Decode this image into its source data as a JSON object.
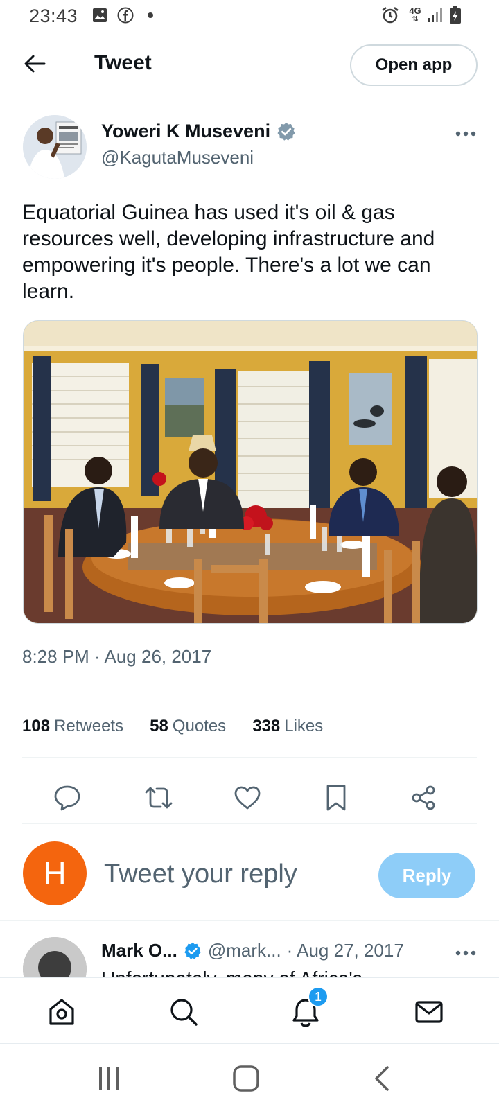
{
  "status_bar": {
    "time": "23:43",
    "icons": [
      "image-icon",
      "facebook-icon",
      "dot-icon",
      "alarm-icon",
      "4g-icon",
      "signal-icon",
      "battery-icon"
    ],
    "network": "4G"
  },
  "header": {
    "title": "Tweet",
    "open_app_label": "Open app"
  },
  "tweet": {
    "author_name": "Yoweri K Museveni",
    "author_handle": "@KagutaMuseveni",
    "text": "Equatorial Guinea has used it's oil & gas resources well, developing infrastructure and empowering it's people. There's a lot we can learn.",
    "timestamp": "8:28 PM · Aug 26, 2017",
    "stats": {
      "retweets": "108",
      "retweets_label": "Retweets",
      "quotes": "58",
      "quotes_label": "Quotes",
      "likes": "338",
      "likes_label": "Likes"
    }
  },
  "reply_box": {
    "avatar_letter": "H",
    "placeholder": "Tweet your reply",
    "button_label": "Reply"
  },
  "reply": {
    "name": "Mark O...",
    "handle": "@mark...",
    "date": "· Aug 27, 2017",
    "text": "Unfortunately, many of Africa's"
  },
  "bottom_nav": {
    "items": [
      "home-icon",
      "search-icon",
      "notifications-icon",
      "messages-icon"
    ],
    "notification_count": "1"
  },
  "colors": {
    "accent": "#1d9bf0",
    "reply_button": "#8ecdf8",
    "avatar_orange": "#f4650e",
    "secondary_text": "#536471",
    "wall_yellow": "#d9a93a"
  }
}
